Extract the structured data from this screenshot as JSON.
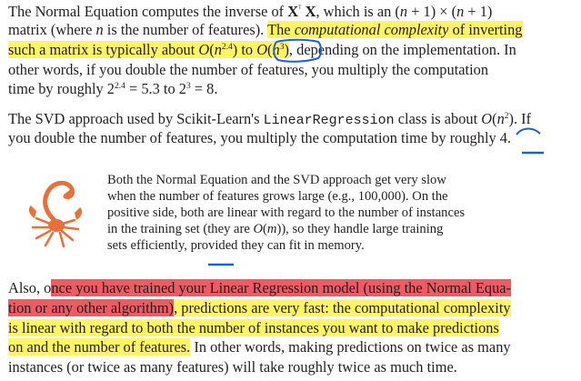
{
  "para1": {
    "l1": [
      "The Normal Equation computes the inverse of ",
      "X",
      "ᵀ",
      " X",
      ", which is an (",
      "n",
      " + 1) × (",
      "n",
      " + 1)"
    ],
    "l2": [
      "matrix (where ",
      "n",
      " is the number of features). ",
      "The ",
      "computational complexity",
      " of inverting"
    ],
    "l3": [
      "such a matrix is typically about ",
      "O",
      "(",
      "n",
      "2.4",
      ") to ",
      "O",
      "(",
      "n",
      "3",
      ")",
      ", depending on the implementation. In"
    ],
    "l4": [
      "other words, if you double the number of features, you multiply the computation"
    ],
    "l5": [
      "time by roughly 2",
      "2.4",
      " = 5.3 to 2",
      "3",
      " = 8."
    ]
  },
  "para2": {
    "l1": [
      "The SVD approach used by Scikit-Learn's ",
      "LinearRegression",
      " class is about ",
      "O",
      "(",
      "n",
      "2",
      "). If"
    ],
    "l2": [
      "you double the number of features, you multiply the computation time by roughly 4."
    ]
  },
  "note": {
    "icon": "scorpion-icon",
    "l1": "Both the Normal Equation and the SVD approach get very slow",
    "l2": "when the number of features grows large (e.g., 100,000). On the",
    "l3": "positive side, both are linear with regard to the number of instances",
    "l4": [
      "in the training set (they are ",
      "O",
      "(",
      "m",
      ")), so they handle large training"
    ],
    "l5": "sets efficiently, provided they can fit in memory."
  },
  "para3": {
    "l1": [
      "Also, o",
      "nce you have trained your Linear Regression model (using the Normal Equa-"
    ],
    "l2": [
      "tion or any other algorithm)",
      ", predictions are very fast: the computational complexity"
    ],
    "l3": [
      "is linear with regard to both the number of instances you want to make predictions"
    ],
    "l4": [
      "on and the number of features.",
      " In other words, making predictions on twice as many"
    ],
    "l5": [
      "instances (or twice as many features) will take roughly twice as much time."
    ]
  },
  "colors": {
    "highlight_yellow": "#fff466",
    "highlight_red": "#ef5a64",
    "pen_blue": "#1f5fd6",
    "scorpion_orange": "#e8703a"
  }
}
